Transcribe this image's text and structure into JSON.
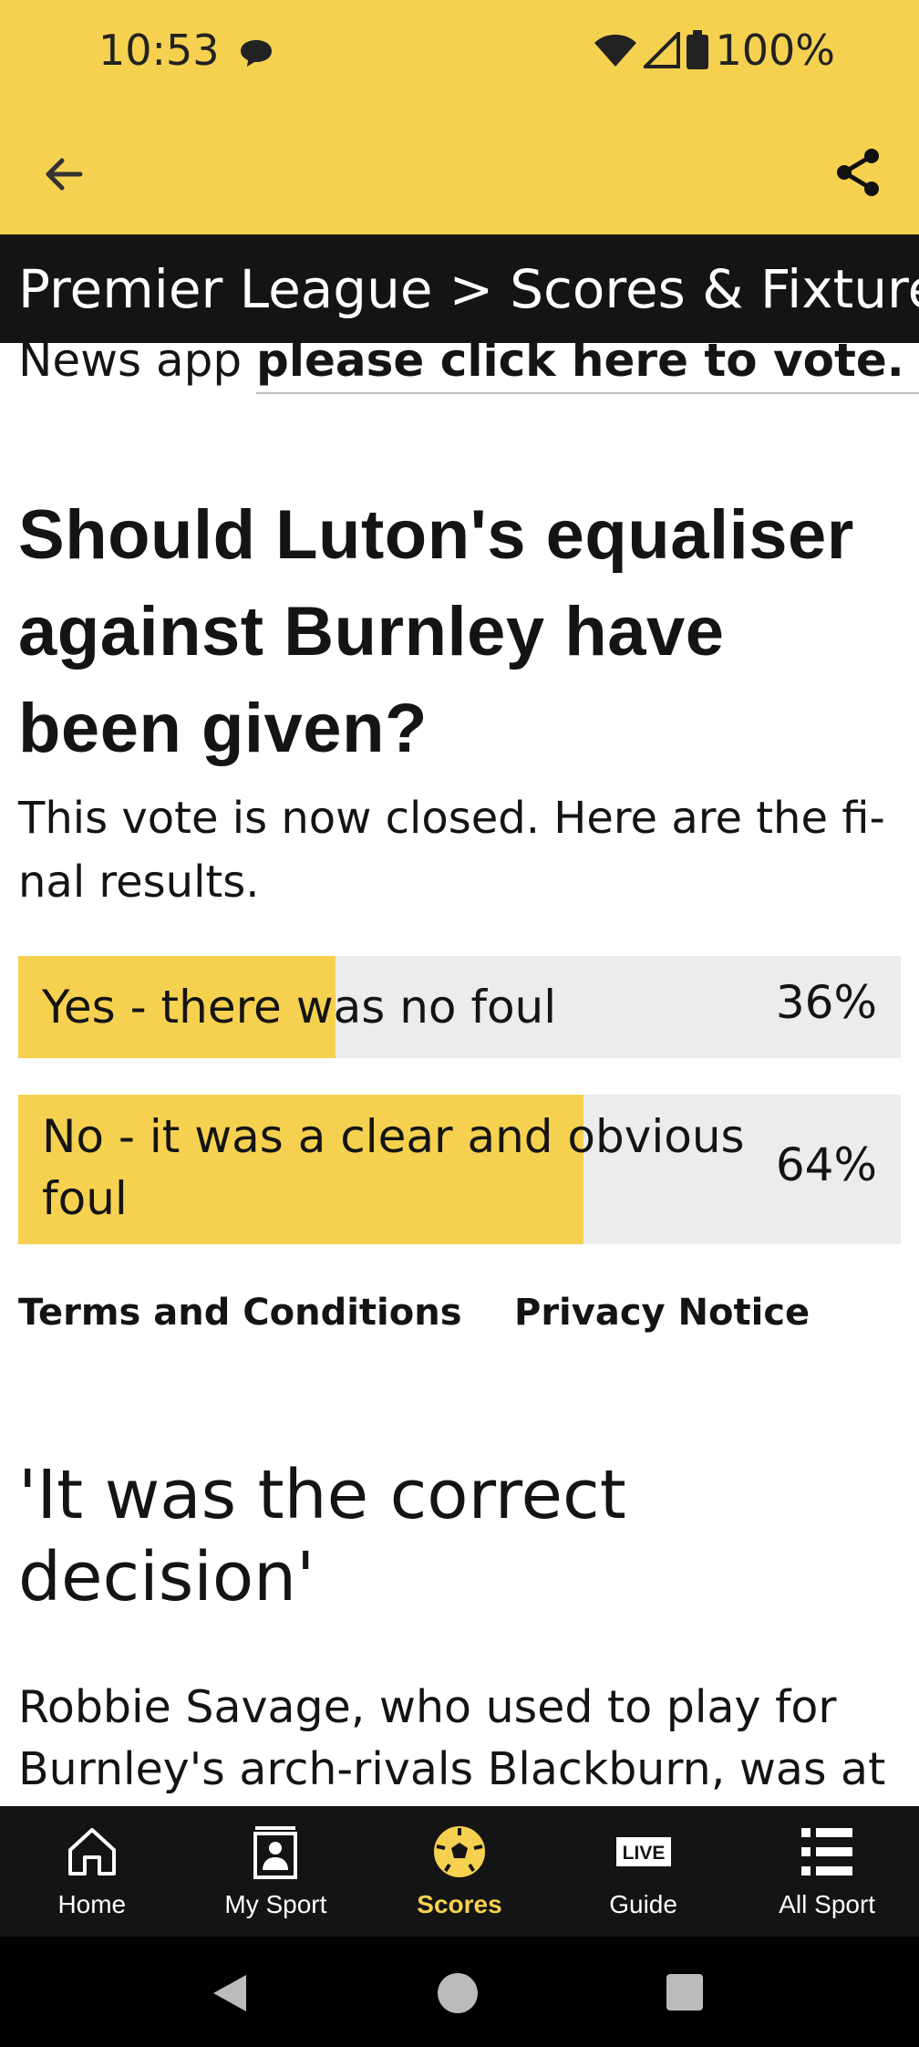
{
  "status_bar": {
    "time": "10:53",
    "battery": "100%",
    "icons": [
      "chat-bubble-icon",
      "wifi-icon",
      "signal-icon",
      "battery-icon"
    ]
  },
  "app_bar": {
    "back_icon": "arrow-left-icon",
    "share_icon": "share-icon"
  },
  "breadcrumb": {
    "league": "Premier League",
    "separator": ">",
    "section": "Scores & Fixtures"
  },
  "article": {
    "cut_prefix": "News app",
    "vote_link": "please click here to vote.",
    "poll": {
      "title": "Should Luton's equaliser against Burnley have been given?",
      "subtitle": "This vote is now closed. Here are the fi-nal results.",
      "options": [
        {
          "label": "Yes - there was no foul",
          "percent": "36%",
          "fill_fraction": 0.36
        },
        {
          "label": "No - it was a clear and obvious foul",
          "percent": "64%",
          "fill_fraction": 0.64
        }
      ],
      "terms_link": "Terms and Conditions",
      "privacy_link": "Privacy Notice"
    },
    "section_heading": "'It was the correct decision'",
    "body": "Robbie Savage, who used to play for Burnley's arch-rivals Blackburn, was at"
  },
  "tab_bar": {
    "tabs": [
      {
        "label": "Home",
        "icon": "home-icon",
        "active": false
      },
      {
        "label": "My Sport",
        "icon": "person-card-icon",
        "active": false
      },
      {
        "label": "Scores",
        "icon": "football-icon",
        "active": true
      },
      {
        "label": "Guide",
        "icon": "live-icon",
        "active": false
      },
      {
        "label": "All Sport",
        "icon": "list-icon",
        "active": false
      }
    ],
    "live_badge": "LIVE"
  },
  "colors": {
    "accent_yellow": "#f6d150",
    "dark": "#141414",
    "poll_bg": "#ececec"
  }
}
